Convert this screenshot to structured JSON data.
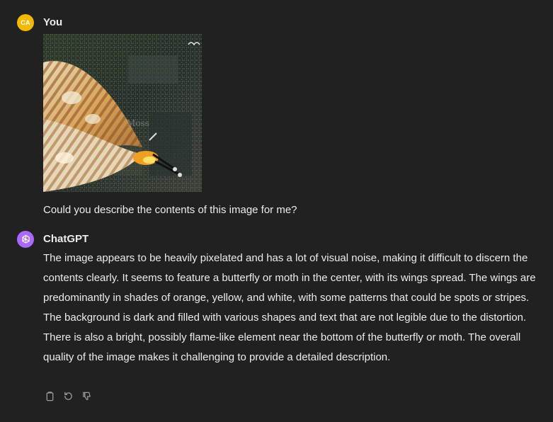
{
  "conversation": {
    "user_message": {
      "avatar_initials": "CA",
      "avatar_color": "#f5b800",
      "author": "You",
      "text": "Could you describe the contents of this image for me?",
      "attachment_icon": "image-attachment"
    },
    "assistant_message": {
      "avatar_icon": "openai-logo-icon",
      "avatar_color": "#ab68ff",
      "author": "ChatGPT",
      "text": "The image appears to be heavily pixelated and has a lot of visual noise, making it difficult to discern the contents clearly. It seems to feature a butterfly or moth in the center, with its wings spread. The wings are predominantly in shades of orange, yellow, and white, with some patterns that could be spots or stripes. The background is dark and filled with various shapes and text that are not legible due to the distortion. There is also a bright, possibly flame-like element near the bottom of the butterfly or moth. The overall quality of the image makes it challenging to provide a detailed description.",
      "actions": [
        {
          "icon": "copy-icon"
        },
        {
          "icon": "regenerate-icon"
        },
        {
          "icon": "thumbs-down-icon"
        }
      ]
    }
  },
  "theme": {
    "background": "#212121",
    "text": "#ececec",
    "muted_icon": "#9b9b9b"
  }
}
